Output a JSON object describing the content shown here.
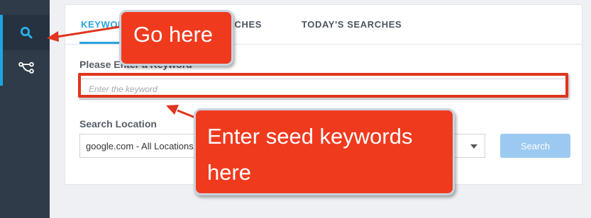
{
  "sidebar": {
    "items": [
      {
        "icon": "search-icon",
        "active": true
      },
      {
        "icon": "share-tree-icon",
        "active": false
      }
    ]
  },
  "tabs": [
    {
      "label": "KEYWORDS"
    },
    {
      "label": "SEARCHES"
    },
    {
      "label": "TODAY'S SEARCHES"
    }
  ],
  "form": {
    "keyword_label": "Please Enter a Keyword",
    "keyword_placeholder": "Enter the keyword",
    "location_label": "Search Location",
    "location_value": "google.com - All Locations",
    "search_button": "Search"
  },
  "annotations": {
    "callout_1": "Go here",
    "callout_2_line1": "Enter seed keywords",
    "callout_2_line2": "here"
  },
  "colors": {
    "sidebar": "#2f3b48",
    "accent": "#29a3e0",
    "callout": "#f03a1e",
    "button": "#9cc9f1"
  }
}
